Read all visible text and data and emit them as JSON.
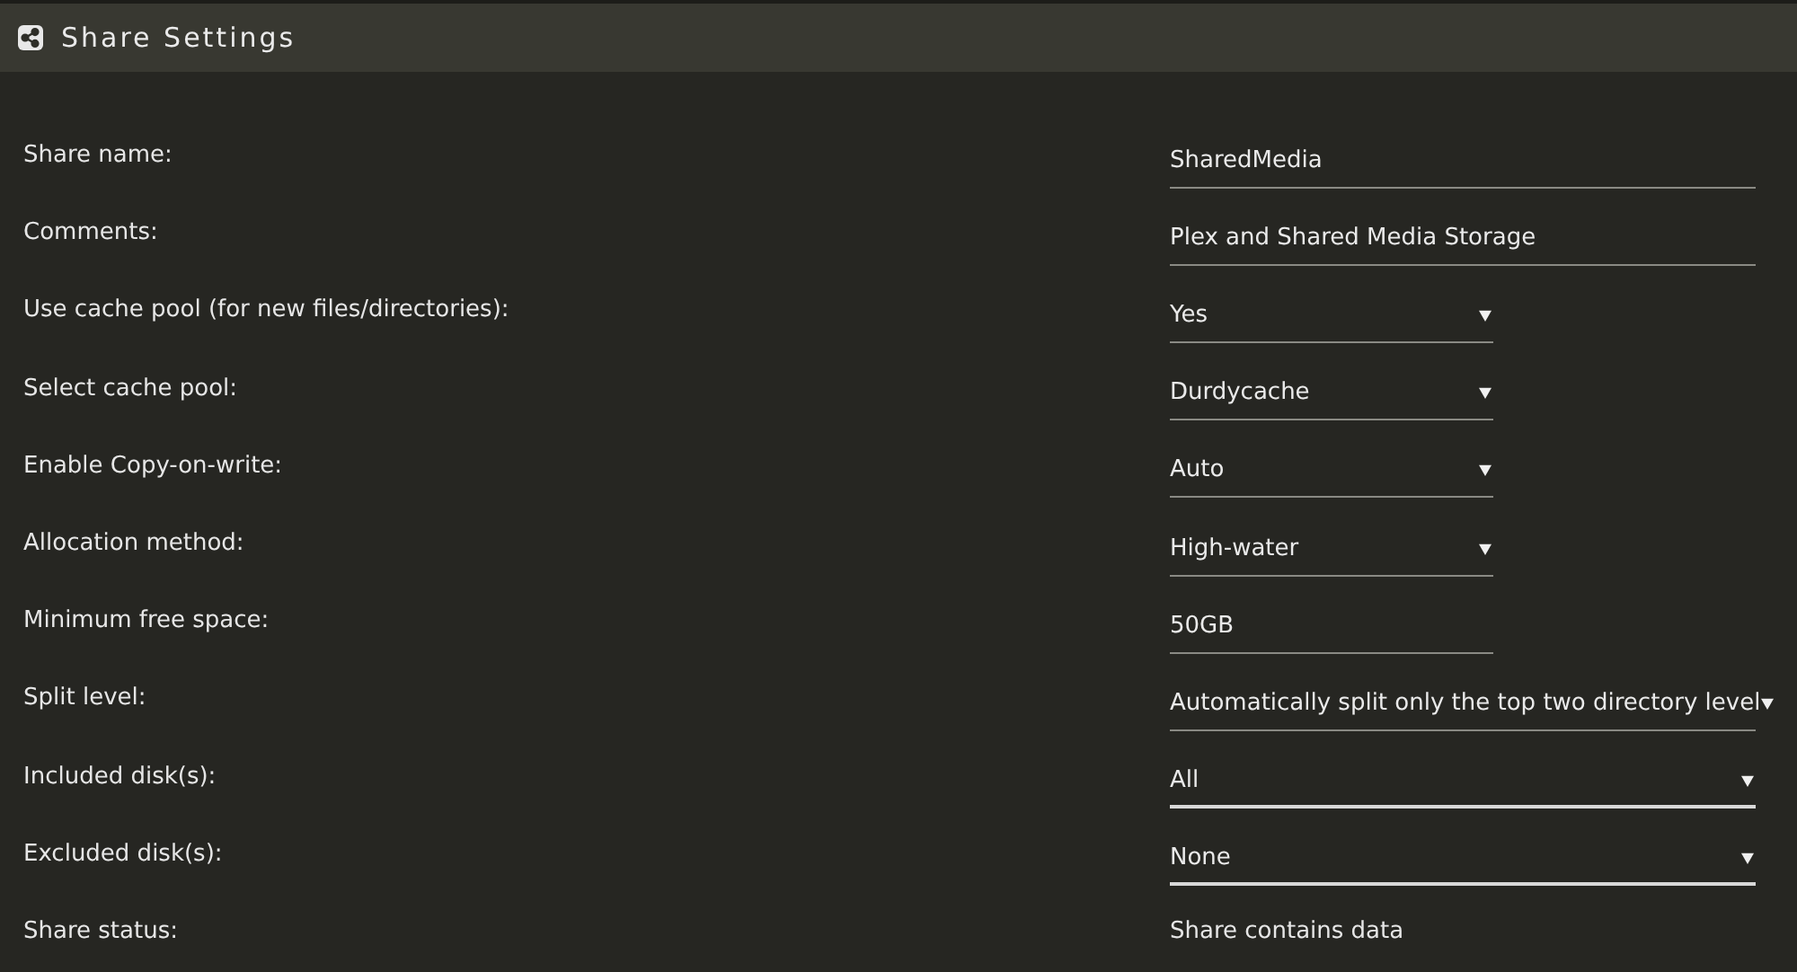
{
  "window": {
    "title": "Share Settings"
  },
  "settings": [
    {
      "label": "Share name:",
      "kind": "text",
      "wide": true,
      "value": "SharedMedia"
    },
    {
      "label": "Comments:",
      "kind": "text",
      "wide": true,
      "value": "Plex and Shared Media Storage"
    },
    {
      "label": "Use cache pool (for new files/directories):",
      "kind": "select",
      "wide": false,
      "value": "Yes"
    },
    {
      "label": "Select cache pool:",
      "kind": "select",
      "wide": false,
      "value": "Durdycache"
    },
    {
      "label": "Enable Copy-on-write:",
      "kind": "select",
      "wide": false,
      "value": "Auto"
    },
    {
      "label": "Allocation method:",
      "kind": "select",
      "wide": false,
      "value": "High-water"
    },
    {
      "label": "Minimum free space:",
      "kind": "text",
      "wide": false,
      "value": "50GB"
    },
    {
      "label": "Split level:",
      "kind": "select",
      "wide": true,
      "value": "Automatically split only the top two directory level"
    },
    {
      "label": "Included disk(s):",
      "kind": "multiselect",
      "wide": true,
      "value": "All"
    },
    {
      "label": "Excluded disk(s):",
      "kind": "multiselect",
      "wide": true,
      "value": "None"
    },
    {
      "label": "Share status:",
      "kind": "status",
      "value": "Share contains data"
    }
  ]
}
